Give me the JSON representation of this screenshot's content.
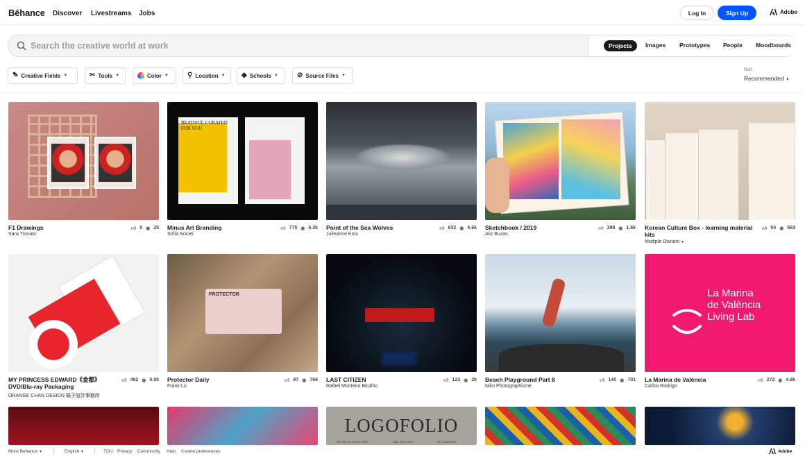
{
  "header": {
    "logo": "Bēhance",
    "nav": [
      "Discover",
      "Livestreams",
      "Jobs"
    ],
    "login_label": "Log In",
    "signup_label": "Sign Up",
    "adobe_label": "Adobe",
    "accent_color": "#0057ff"
  },
  "search": {
    "placeholder": "Search the creative world at work",
    "tabs": [
      "Projects",
      "Images",
      "Prototypes",
      "People",
      "Moodboards"
    ],
    "active_tab": "Projects"
  },
  "filters": {
    "items": [
      {
        "label": "Creative Fields",
        "icon": "creative-fields-icon"
      },
      {
        "label": "Tools",
        "icon": "tools-icon"
      },
      {
        "label": "Color",
        "icon": "color-wheel-icon"
      },
      {
        "label": "Location",
        "icon": "location-pin-icon"
      },
      {
        "label": "Schools",
        "icon": "graduation-cap-icon"
      },
      {
        "label": "Source Files",
        "icon": "paperclip-icon"
      }
    ],
    "sort_label": "Sort",
    "sort_value": "Recommended"
  },
  "projects": [
    {
      "title": "F1 Drawings",
      "owner": "Sara Trovato",
      "likes": "0",
      "views": "25"
    },
    {
      "title": "Minus Art Branding",
      "owner": "Sofia Noceti",
      "likes": "775",
      "views": "6.3k"
    },
    {
      "title": "Point of the Sea Wolves",
      "owner": "Julieanne Kost",
      "likes": "632",
      "views": "4.6k"
    },
    {
      "title": "Sketchbook / 2019",
      "owner": "Aliz Buzas",
      "likes": "398",
      "views": "1.6k"
    },
    {
      "title": "Korean Culture Box - learning material kits",
      "owner": "Multiple Owners",
      "likes": "54",
      "views": "683"
    },
    {
      "title": "MY PRINCESS EDWARD《金都》DVD/Blu-ray Packaging",
      "owner": "ORANGE CHAN DESIGN 橘子設計事務所",
      "likes": "492",
      "views": "5.5k"
    },
    {
      "title": "Protector Daily",
      "owner": "Frank Lo",
      "likes": "97",
      "views": "766"
    },
    {
      "title": "LAST CITIZEN",
      "owner": "Rafael Monteiro Bicalho",
      "likes": "123",
      "views": "2k"
    },
    {
      "title": "Beach Playground Part 8",
      "owner": "Niko Photographisme",
      "likes": "140",
      "views": "701"
    },
    {
      "title": "La Marina de València",
      "owner": "Carlos Rodrigo",
      "likes": "272",
      "views": "4.6k"
    }
  ],
  "thumb_text": {
    "marina": "La Marina\nde València\nLiving Lab",
    "logofolio": "LOGOFOLIO",
    "logofolio_sub1": "PROJECTS DEVELOPED",
    "logofolio_sub2": "JAN - DEC 2020",
    "logofolio_sub3": "BY OLDGULFIL",
    "protector": "PROTECTOR",
    "minus_text": "BEATIFUL CURATED FOR YOU"
  },
  "footer": {
    "more": "More Behance",
    "language": "English",
    "links": [
      "TOU",
      "Privacy",
      "Community",
      "Help",
      "Cookie preferences"
    ],
    "adobe": "Adobe"
  }
}
